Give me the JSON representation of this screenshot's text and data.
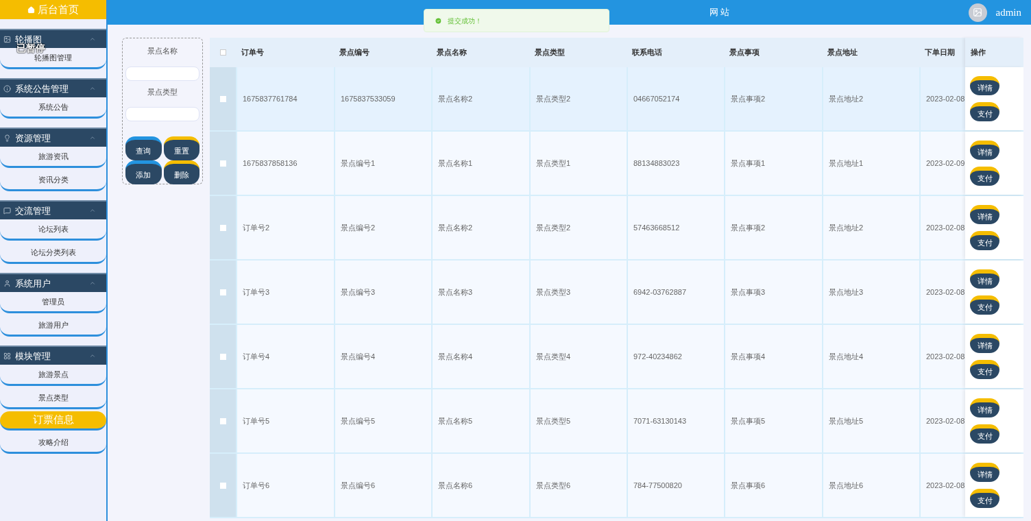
{
  "sidebar": {
    "home": {
      "label": "后台首页",
      "selected": false
    },
    "groups": [
      {
        "title": "轮播图",
        "expanded": true,
        "items": [
          {
            "label": "轮播图管理",
            "selected": false
          }
        ]
      },
      {
        "title": "系统公告管理",
        "expanded": true,
        "items": [
          {
            "label": "系统公告",
            "selected": false
          }
        ]
      },
      {
        "title": "资源管理",
        "expanded": true,
        "items": [
          {
            "label": "旅游资讯",
            "selected": false
          },
          {
            "label": "资讯分类",
            "selected": false
          }
        ]
      },
      {
        "title": "交流管理",
        "expanded": true,
        "items": [
          {
            "label": "论坛列表",
            "selected": false
          },
          {
            "label": "论坛分类列表",
            "selected": false
          }
        ]
      },
      {
        "title": "系统用户",
        "expanded": true,
        "items": [
          {
            "label": "管理员",
            "selected": false
          },
          {
            "label": "旅游用户",
            "selected": false
          }
        ]
      },
      {
        "title": "模块管理",
        "expanded": true,
        "items": [
          {
            "label": "旅游景点",
            "selected": false
          },
          {
            "label": "景点类型",
            "selected": false
          },
          {
            "label": "订票信息",
            "selected": true
          },
          {
            "label": "攻略介绍",
            "selected": false
          }
        ]
      }
    ]
  },
  "overlay": {
    "paused": "已暂停"
  },
  "header": {
    "title": "网站",
    "user": "admin"
  },
  "toast": {
    "message": "提交成功！"
  },
  "search": {
    "fields": [
      {
        "label": "景点名称"
      },
      {
        "label": "景点类型"
      }
    ],
    "buttons": [
      {
        "label": "查询",
        "color": "#2394e0"
      },
      {
        "label": "重置",
        "color": "#f5bd00"
      },
      {
        "label": "添加",
        "color": "#2394e0"
      },
      {
        "label": "删除",
        "color": "#f5bd00"
      }
    ]
  },
  "table": {
    "columns": [
      "订单号",
      "景点编号",
      "景点名称",
      "景点类型",
      "联系电话",
      "景点事项",
      "景点地址",
      "下单日期",
      "操作"
    ],
    "all_checked": false,
    "rows": [
      {
        "selected": true,
        "checked": false,
        "cells": [
          "1675837761784",
          "1675837533059",
          "景点名称2",
          "景点类型2",
          "04667052174",
          "景点事项2",
          "景点地址2",
          "2023-02-08"
        ],
        "actions": [
          "详情",
          "支付"
        ]
      },
      {
        "selected": false,
        "checked": false,
        "cells": [
          "1675837858136",
          "景点编号1",
          "景点名称1",
          "景点类型1",
          "88134883023",
          "景点事项1",
          "景点地址1",
          "2023-02-09"
        ],
        "actions": [
          "详情",
          "支付"
        ]
      },
      {
        "selected": false,
        "checked": false,
        "cells": [
          "订单号2",
          "景点编号2",
          "景点名称2",
          "景点类型2",
          "57463668512",
          "景点事项2",
          "景点地址2",
          "2023-02-08"
        ],
        "actions": [
          "详情",
          "支付"
        ]
      },
      {
        "selected": false,
        "checked": false,
        "cells": [
          "订单号3",
          "景点编号3",
          "景点名称3",
          "景点类型3",
          "6942-03762887",
          "景点事项3",
          "景点地址3",
          "2023-02-08"
        ],
        "actions": [
          "详情",
          "支付"
        ]
      },
      {
        "selected": false,
        "checked": false,
        "cells": [
          "订单号4",
          "景点编号4",
          "景点名称4",
          "景点类型4",
          "972-40234862",
          "景点事项4",
          "景点地址4",
          "2023-02-08"
        ],
        "actions": [
          "详情",
          "支付"
        ]
      },
      {
        "selected": false,
        "checked": false,
        "cells": [
          "订单号5",
          "景点编号5",
          "景点名称5",
          "景点类型5",
          "7071-63130143",
          "景点事项5",
          "景点地址5",
          "2023-02-08"
        ],
        "actions": [
          "详情",
          "支付"
        ]
      },
      {
        "selected": false,
        "checked": false,
        "cells": [
          "订单号6",
          "景点编号6",
          "景点名称6",
          "景点类型6",
          "784-77500820",
          "景点事项6",
          "景点地址6",
          "2023-02-08"
        ],
        "actions": [
          "详情",
          "支付"
        ]
      }
    ]
  }
}
